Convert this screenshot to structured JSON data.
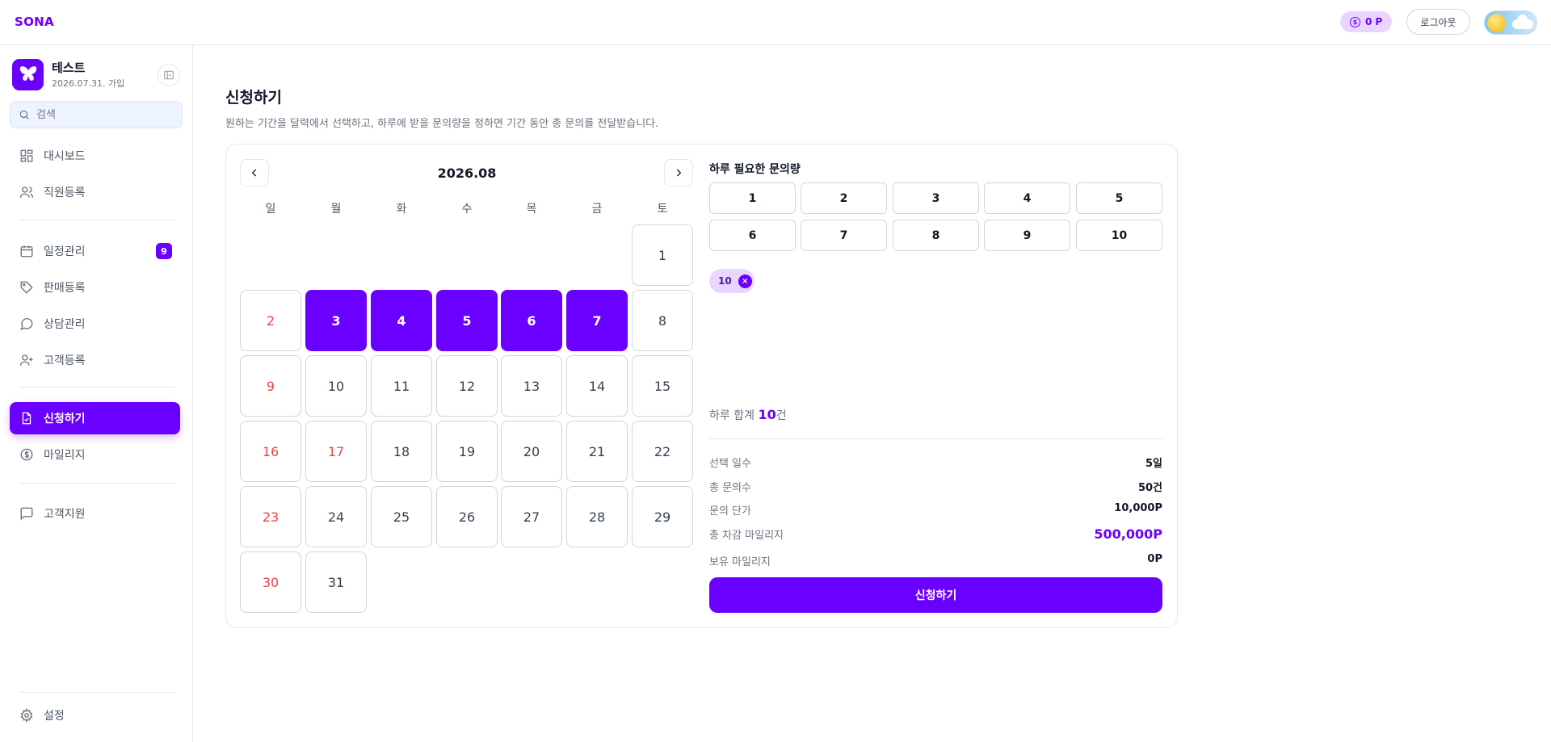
{
  "brand": "SONA",
  "header": {
    "points": "0 P",
    "logout": "로그아웃"
  },
  "profile": {
    "name": "테스트",
    "joined": "2026.07.31. 가입"
  },
  "search": {
    "placeholder": "검색"
  },
  "nav": {
    "dashboard": "대시보드",
    "staff": "직원등록",
    "schedule": "일정관리",
    "schedule_badge": "9",
    "sales": "판매등록",
    "consult": "상담관리",
    "customer": "고객등록",
    "apply": "신청하기",
    "mileage": "마일리지",
    "support": "고객지원",
    "settings": "설정"
  },
  "page": {
    "title": "신청하기",
    "description": "원하는 기간을 달력에서 선택하고, 하루에 받을 문의량을 정하면 기간 동안 총 문의를 전달받습니다."
  },
  "calendar": {
    "month": "2026.08",
    "weekdays": [
      "일",
      "월",
      "화",
      "수",
      "목",
      "금",
      "토"
    ],
    "first_weekday": 6,
    "days": 31,
    "selected": [
      3,
      4,
      5,
      6,
      7
    ],
    "holidays": [
      17
    ]
  },
  "quantity": {
    "title": "하루 필요한 문의량",
    "options": [
      "1",
      "2",
      "3",
      "4",
      "5",
      "6",
      "7",
      "8",
      "9",
      "10"
    ],
    "chip": "10",
    "chip_remove": "×"
  },
  "summary": {
    "daily_prefix": "하루 합계",
    "daily_value": "10",
    "daily_suffix": "건",
    "rows": [
      {
        "label": "선택 일수",
        "value": "5일"
      },
      {
        "label": "총 문의수",
        "value": "50건"
      },
      {
        "label": "문의 단가",
        "value": "10,000P"
      },
      {
        "label": "총 차감 마일리지",
        "value": "500,000P"
      },
      {
        "label": "보유 마일리지",
        "value": "0P"
      }
    ],
    "submit": "신청하기"
  },
  "colors": {
    "accent": "#6a00ff",
    "sunday": "#ef4444"
  }
}
